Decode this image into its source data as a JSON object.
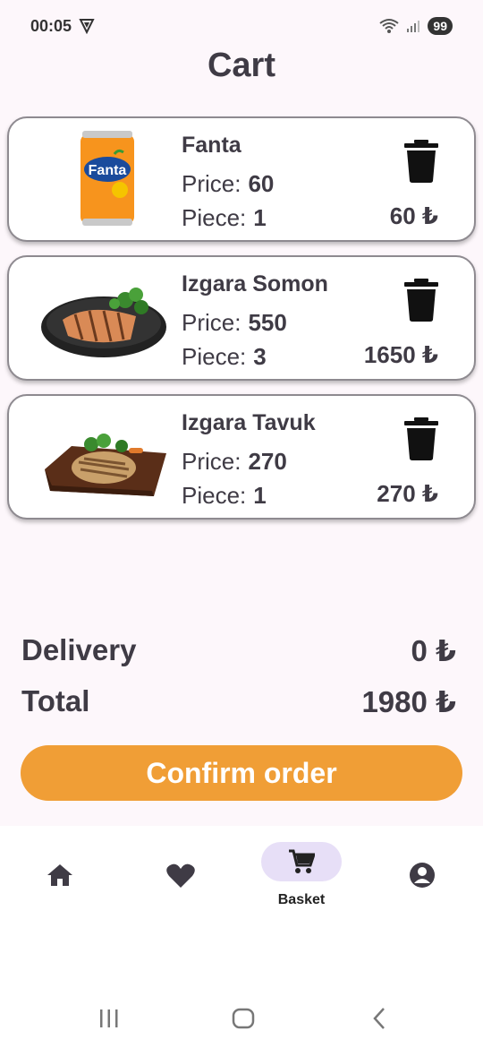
{
  "status_bar": {
    "time": "00:05",
    "battery": "99"
  },
  "page": {
    "title": "Cart"
  },
  "cart": {
    "items": [
      {
        "name": "Fanta",
        "price_label": "Price:",
        "price": "60",
        "piece_label": "Piece:",
        "piece": "1",
        "line_total": "60 ₺",
        "image": "fanta-can-image"
      },
      {
        "name": "Izgara Somon",
        "price_label": "Price:",
        "price": "550",
        "piece_label": "Piece:",
        "piece": "3",
        "line_total": "1650 ₺",
        "image": "grilled-salmon-image"
      },
      {
        "name": "Izgara Tavuk",
        "price_label": "Price:",
        "price": "270",
        "piece_label": "Piece:",
        "piece": "1",
        "line_total": "270 ₺",
        "image": "grilled-chicken-image"
      }
    ]
  },
  "summary": {
    "delivery_label": "Delivery",
    "delivery_value": "0 ₺",
    "total_label": "Total",
    "total_value": "1980 ₺"
  },
  "confirm": {
    "label": "Confirm order"
  },
  "bottom_nav": {
    "items": [
      {
        "icon": "home-icon",
        "label": ""
      },
      {
        "icon": "heart-icon",
        "label": ""
      },
      {
        "icon": "cart-icon",
        "label": "Basket",
        "active": true
      },
      {
        "icon": "account-icon",
        "label": ""
      }
    ]
  },
  "colors": {
    "accent": "#f09e36",
    "background": "#fdf7fb",
    "nav_active_pill": "#e7dff7",
    "text": "#3f3b45"
  }
}
